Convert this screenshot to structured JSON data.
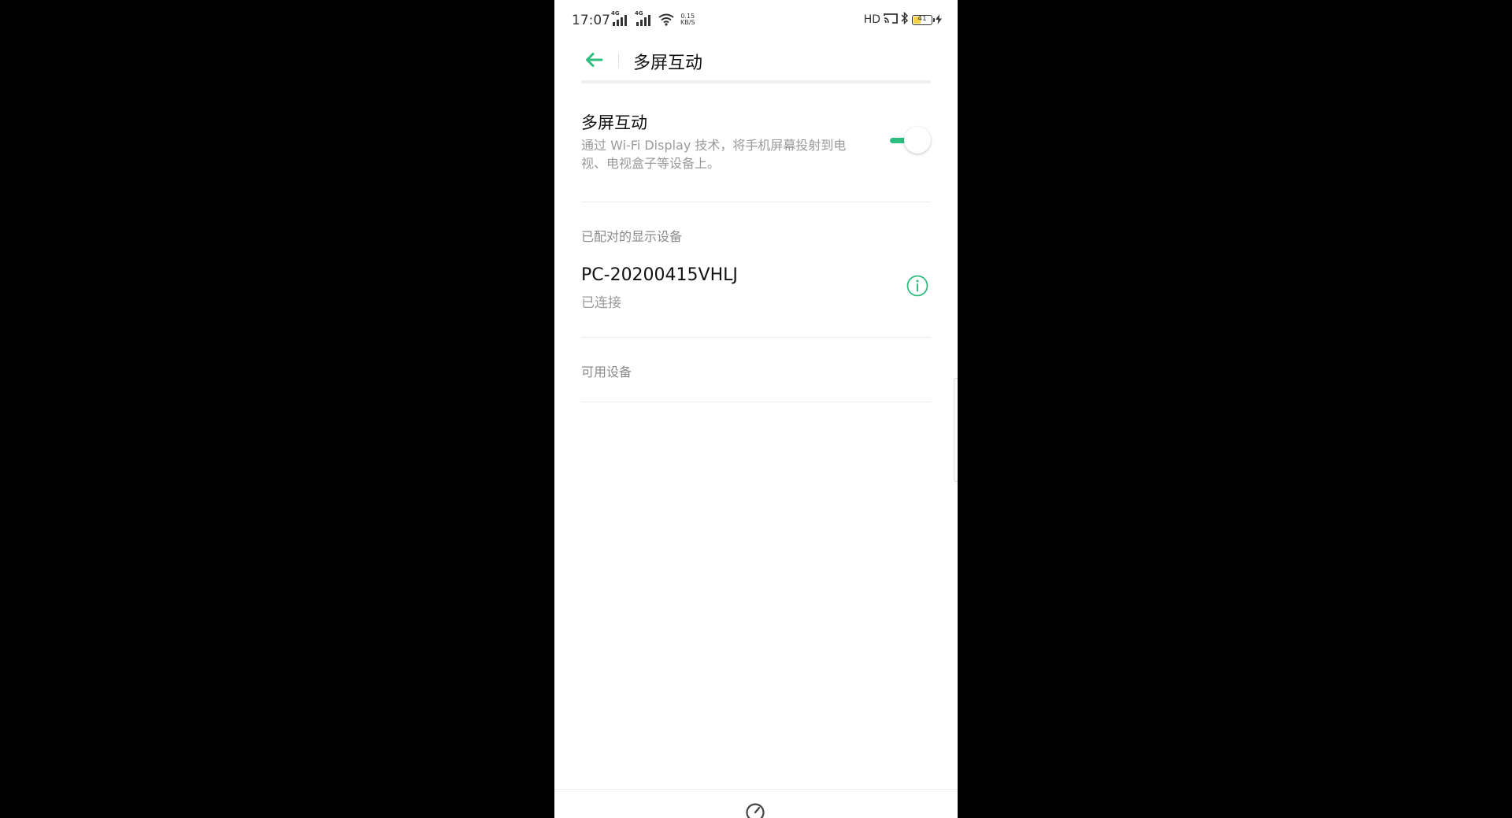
{
  "status_bar": {
    "time": "17:07",
    "signal1_tag": "4G",
    "signal2_tag": "4G",
    "netspeed_value": "0.15",
    "netspeed_unit": "KB/S",
    "hd_label": "HD",
    "battery_level": "41",
    "battery_fraction": 0.41,
    "icons": [
      "signal-icon",
      "signal-icon",
      "wifi-icon",
      "hd-icon",
      "cast-icon",
      "bluetooth-icon",
      "battery-icon",
      "charging-icon"
    ]
  },
  "header": {
    "title": "多屏互动",
    "back_icon": "back-arrow-icon"
  },
  "multiscreen": {
    "title": "多屏互动",
    "description": "通过 Wi-Fi Display 技术，将手机屏幕投射到电视、电视盒子等设备上。",
    "toggle_on": true
  },
  "paired": {
    "section_label": "已配对的显示设备",
    "devices": [
      {
        "name": "PC-20200415VHLJ",
        "status": "已连接"
      }
    ]
  },
  "available": {
    "section_label": "可用设备"
  },
  "colors": {
    "accent": "#2dbd7e",
    "background": "#ffffff",
    "letterbox": "#000000",
    "secondary_text": "#9a9a9a"
  }
}
